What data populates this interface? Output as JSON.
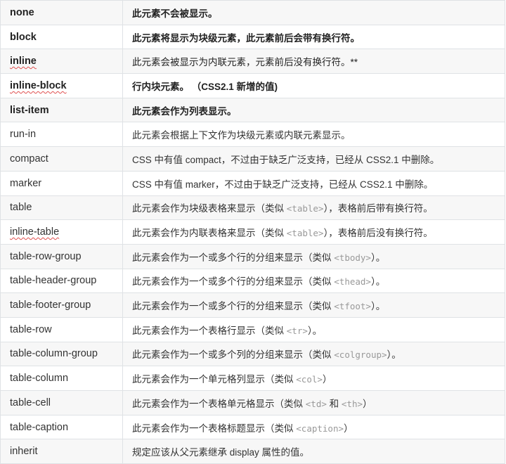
{
  "rows": [
    {
      "value": "none",
      "bold": true,
      "desc": [
        {
          "t": "此元素不会被显示。"
        }
      ]
    },
    {
      "value": "block",
      "bold": true,
      "desc": [
        {
          "t": "此元素将显示为块级元素，此元素前后会带有换行符。"
        }
      ]
    },
    {
      "value": "inline",
      "bold": true,
      "spell": true,
      "desc": [
        {
          "t": "此元素会被显示为内联元素，元素前后没有换行符。**",
          "normal": true
        }
      ]
    },
    {
      "value": "inline-block",
      "bold": true,
      "spell": true,
      "desc": [
        {
          "t": "行内块元素。 （CSS2.1 新增的值)"
        }
      ]
    },
    {
      "value": "list-item",
      "bold": true,
      "desc": [
        {
          "t": "此元素会作为列表显示。"
        }
      ]
    },
    {
      "value": "run-in",
      "desc": [
        {
          "t": "此元素会根据上下文作为块级元素或内联元素显示。"
        }
      ]
    },
    {
      "value": "compact",
      "desc": [
        {
          "t": "CSS 中有值 compact，不过由于缺乏广泛支持，已经从 CSS2.1 中删除。"
        }
      ]
    },
    {
      "value": "marker",
      "desc": [
        {
          "t": "CSS 中有值 marker，不过由于缺乏广泛支持，已经从 CSS2.1 中删除。"
        }
      ]
    },
    {
      "value": "table",
      "desc": [
        {
          "t": "此元素会作为块级表格来显示（类似 "
        },
        {
          "t": "<table>",
          "code": true
        },
        {
          "t": "），表格前后带有换行符。"
        }
      ]
    },
    {
      "value": "inline-table",
      "spell": true,
      "desc": [
        {
          "t": "此元素会作为内联表格来显示（类似 "
        },
        {
          "t": "<table>",
          "code": true
        },
        {
          "t": "），表格前后没有换行符。"
        }
      ]
    },
    {
      "value": "table-row-group",
      "desc": [
        {
          "t": "此元素会作为一个或多个行的分组来显示（类似 "
        },
        {
          "t": "<tbody>",
          "code": true
        },
        {
          "t": "）。"
        }
      ]
    },
    {
      "value": "table-header-group",
      "desc": [
        {
          "t": "此元素会作为一个或多个行的分组来显示（类似 "
        },
        {
          "t": "<thead>",
          "code": true
        },
        {
          "t": "）。"
        }
      ]
    },
    {
      "value": "table-footer-group",
      "desc": [
        {
          "t": "此元素会作为一个或多个行的分组来显示（类似 "
        },
        {
          "t": "<tfoot>",
          "code": true
        },
        {
          "t": "）。"
        }
      ]
    },
    {
      "value": "table-row",
      "desc": [
        {
          "t": "此元素会作为一个表格行显示（类似 "
        },
        {
          "t": "<tr>",
          "code": true
        },
        {
          "t": "）。"
        }
      ]
    },
    {
      "value": "table-column-group",
      "desc": [
        {
          "t": "此元素会作为一个或多个列的分组来显示（类似 "
        },
        {
          "t": "<colgroup>",
          "code": true
        },
        {
          "t": "）。"
        }
      ]
    },
    {
      "value": "table-column",
      "desc": [
        {
          "t": "此元素会作为一个单元格列显示（类似 "
        },
        {
          "t": "<col>",
          "code": true
        },
        {
          "t": "）"
        }
      ]
    },
    {
      "value": "table-cell",
      "desc": [
        {
          "t": "此元素会作为一个表格单元格显示（类似 "
        },
        {
          "t": "<td>",
          "code": true
        },
        {
          "t": " 和 "
        },
        {
          "t": "<th>",
          "code": true
        },
        {
          "t": "）"
        }
      ]
    },
    {
      "value": "table-caption",
      "desc": [
        {
          "t": "此元素会作为一个表格标题显示（类似 "
        },
        {
          "t": "<caption>",
          "code": true
        },
        {
          "t": "）"
        }
      ]
    },
    {
      "value": "inherit",
      "desc": [
        {
          "t": "规定应该从父元素继承 display 属性的值。"
        }
      ]
    }
  ]
}
